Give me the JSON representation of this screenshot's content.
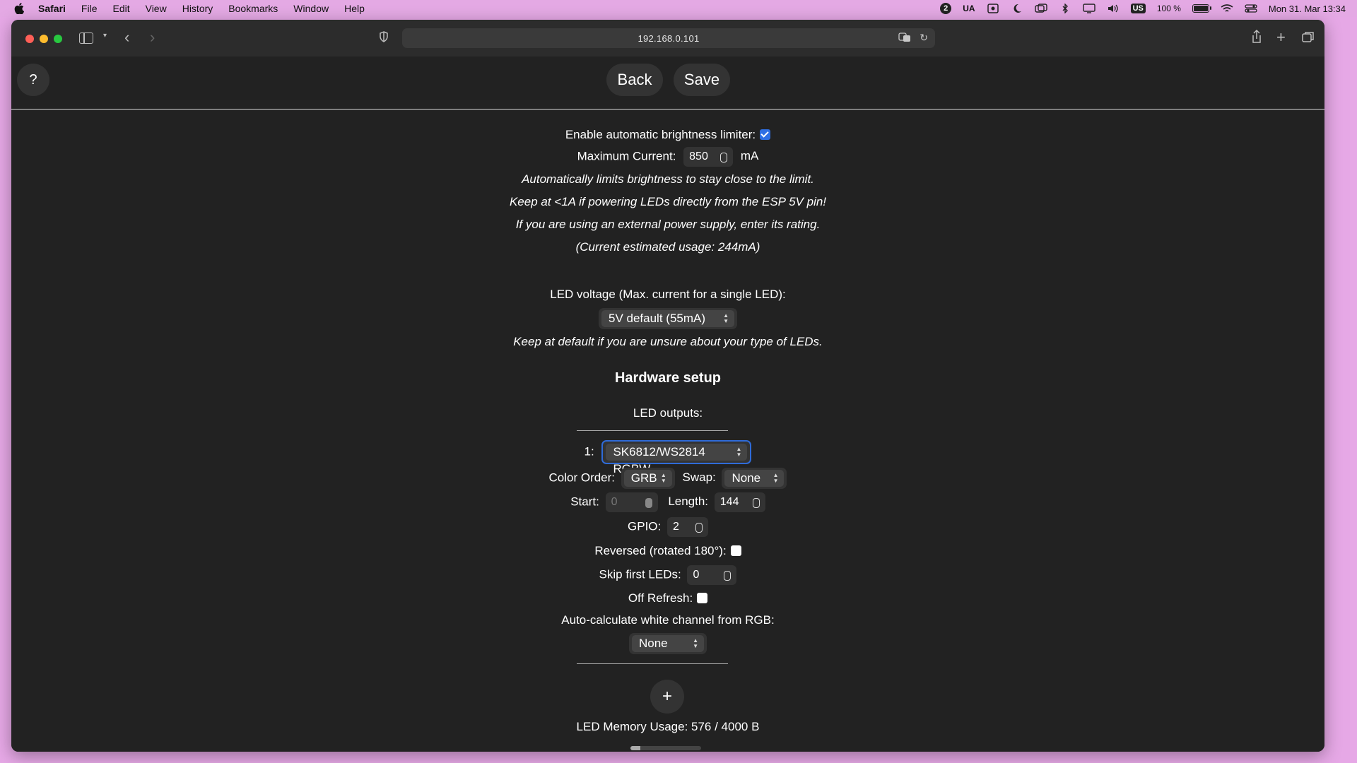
{
  "menubar": {
    "items": [
      "Safari",
      "File",
      "Edit",
      "View",
      "History",
      "Bookmarks",
      "Window",
      "Help"
    ],
    "input_language": "UA",
    "keyboard_badge": "US",
    "battery": "100 %",
    "battery_level": 1.0,
    "clock": "Mon 31. Mar  13:34"
  },
  "browser": {
    "url": "192.168.0.101"
  },
  "nav": {
    "help": "?",
    "back": "Back",
    "save": "Save"
  },
  "brightness": {
    "enable_label": "Enable automatic brightness limiter:",
    "enabled": true,
    "max_current_label": "Maximum Current:",
    "max_current_value": "850",
    "max_current_unit": "mA",
    "note1": "Automatically limits brightness to stay close to the limit.",
    "note2": "Keep at <1A if powering LEDs directly from the ESP 5V pin!",
    "note3": "If you are using an external power supply, enter its rating.",
    "note4": "(Current estimated usage: 244mA)",
    "voltage_label": "LED voltage (Max. current for a single LED):",
    "voltage_value": "5V default (55mA)",
    "voltage_note": "Keep at default if you are unsure about your type of LEDs."
  },
  "hardware": {
    "title": "Hardware setup",
    "outputs_label": "LED outputs:",
    "output_index": "1:",
    "led_type": "SK6812/WS2814 RGBW",
    "color_order_label": "Color Order:",
    "color_order": "GRB",
    "swap_label": "Swap:",
    "swap": "None",
    "start_label": "Start:",
    "start": "0",
    "length_label": "Length:",
    "length": "144",
    "gpio_label": "GPIO:",
    "gpio": "2",
    "reversed_label": "Reversed (rotated 180°):",
    "reversed": false,
    "skip_label": "Skip first LEDs:",
    "skip": "0",
    "off_refresh_label": "Off Refresh:",
    "off_refresh": false,
    "white_label": "Auto-calculate white channel from RGB:",
    "white_mode": "None",
    "add_button": "+",
    "memory_label": "LED Memory Usage: 576 / 4000 B",
    "memory_fraction": 0.144
  }
}
